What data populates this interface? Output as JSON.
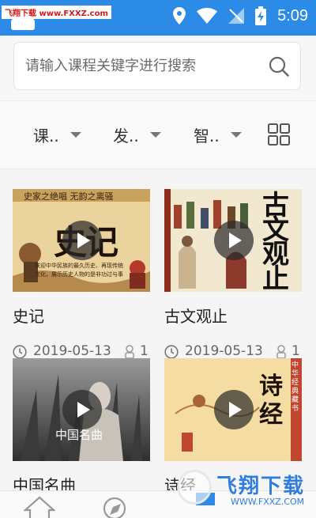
{
  "watermark": {
    "top_text": "飞翔下载 www.FXXZ.com",
    "brand_cn": "飞翔下载",
    "brand_url": "WWW.FXXZ.COM"
  },
  "status_bar": {
    "time": "5:09",
    "background": "#2b8be6"
  },
  "search": {
    "placeholder": "请输入课程关键字进行搜索"
  },
  "filters": [
    {
      "label": "课.."
    },
    {
      "label": "发.."
    },
    {
      "label": "智.."
    }
  ],
  "courses": [
    {
      "title": "史记",
      "date": "2019-05-13",
      "count": "1",
      "thumb_banner": "史家之绝唱 无韵之离骚",
      "thumb_main": "史记",
      "thumb_caption": "联迎中华民族的最久历史、再现传统文化，展示历史人物的是非功过与事变"
    },
    {
      "title": "古文观止",
      "date": "2019-05-13",
      "count": "1",
      "thumb_main": "古文观止"
    },
    {
      "title": "中国名曲",
      "thumb_overlay": "中国名曲"
    },
    {
      "title": "诗经",
      "thumb_main": "诗经",
      "thumb_side": "中华经典藏书"
    }
  ]
}
